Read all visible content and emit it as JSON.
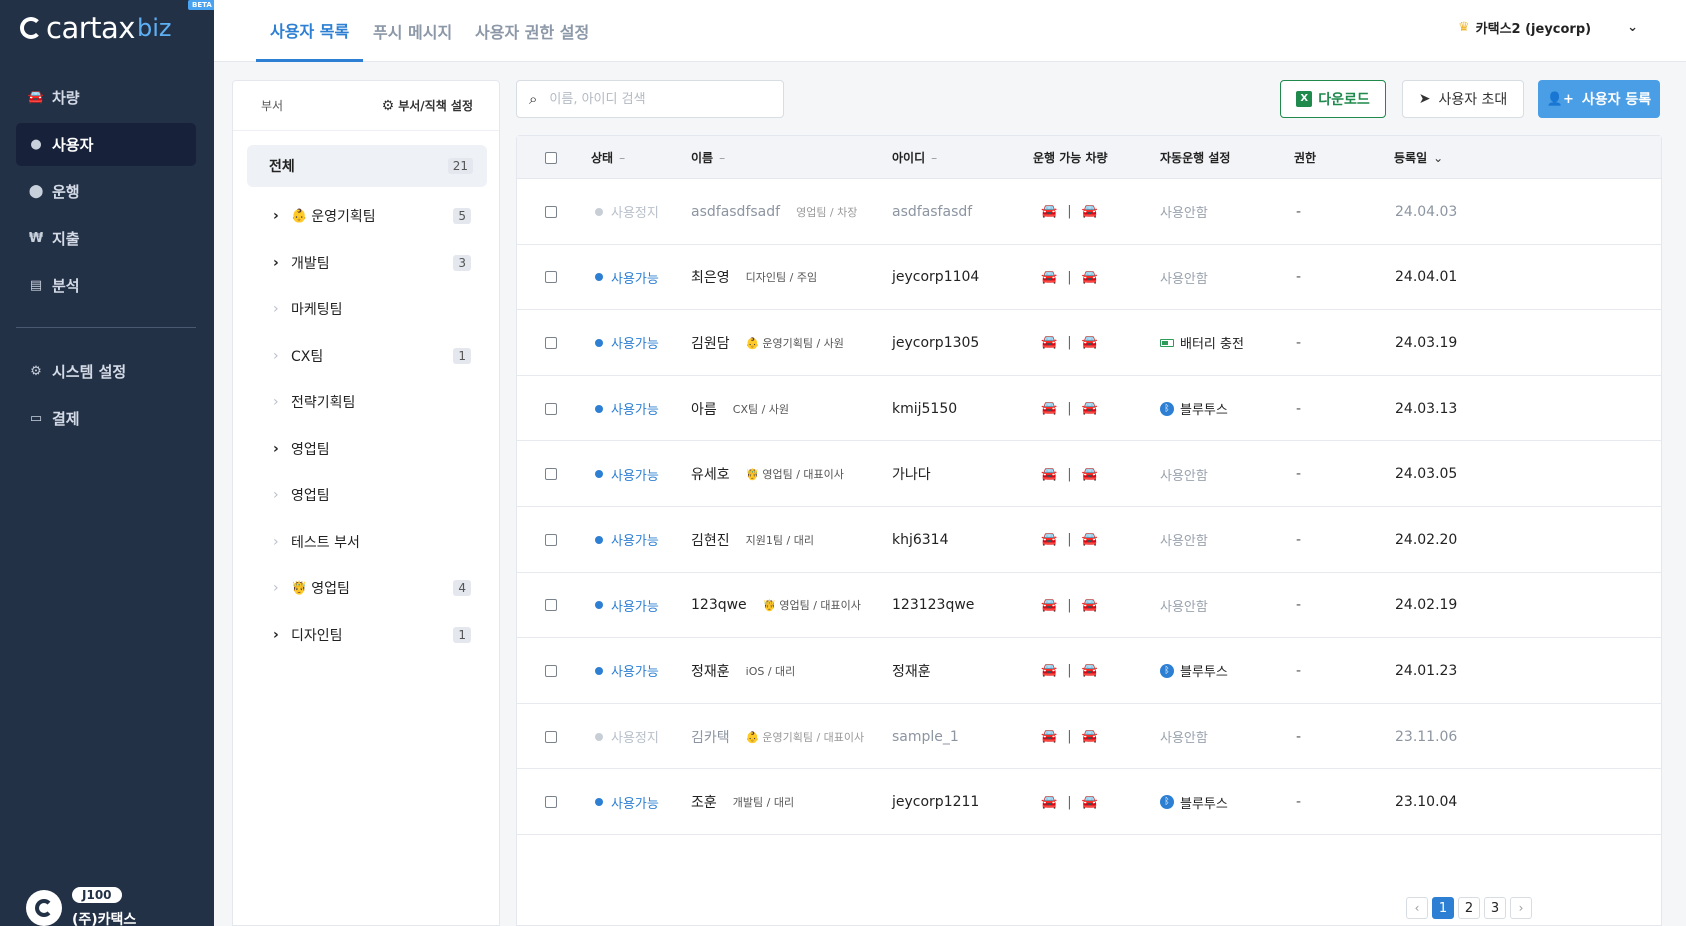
{
  "app": {
    "logo_text": "cartax",
    "logo_suffix": "biz",
    "beta_label": "BETA"
  },
  "sidebar": {
    "items": [
      {
        "label": "차량",
        "icon": "car-icon"
      },
      {
        "label": "사용자",
        "icon": "user-icon",
        "active": true
      },
      {
        "label": "운행",
        "icon": "location-pin-icon"
      },
      {
        "label": "지출",
        "icon": "won-icon"
      },
      {
        "label": "분석",
        "icon": "chart-icon"
      }
    ],
    "items2": [
      {
        "label": "시스템 설정",
        "icon": "gear-icon"
      },
      {
        "label": "결제",
        "icon": "card-icon"
      }
    ],
    "company": {
      "plan": "J100",
      "name": "(주)카택스"
    }
  },
  "tabs": [
    {
      "label": "사용자 목록",
      "active": true
    },
    {
      "label": "푸시 메시지"
    },
    {
      "label": "사용자 권한 설정"
    }
  ],
  "account": {
    "label": "카택스2 (jeycorp)"
  },
  "dept": {
    "title": "부서",
    "settings_label": "부서/직책 설정",
    "all_label": "전체",
    "all_count": "21",
    "items": [
      {
        "label": "운영기획팀",
        "emoji": "👶",
        "expandable": true,
        "count": "5"
      },
      {
        "label": "개발팀",
        "emoji": "",
        "expandable": true,
        "count": "3"
      },
      {
        "label": "마케팅팀",
        "emoji": "",
        "expandable": false,
        "count": ""
      },
      {
        "label": "CX팀",
        "emoji": "",
        "expandable": false,
        "count": "1"
      },
      {
        "label": "전략기획팀",
        "emoji": "",
        "expandable": false,
        "count": ""
      },
      {
        "label": "영업팀",
        "emoji": "",
        "expandable": true,
        "count": ""
      },
      {
        "label": "영업팀",
        "emoji": "",
        "expandable": false,
        "count": ""
      },
      {
        "label": "테스트 부서",
        "emoji": "",
        "expandable": false,
        "count": ""
      },
      {
        "label": "영업팀",
        "emoji": "🤴",
        "expandable": false,
        "count": "4"
      },
      {
        "label": "디자인팀",
        "emoji": "",
        "expandable": true,
        "count": "1"
      }
    ]
  },
  "search": {
    "placeholder": "이름, 아이디 검색"
  },
  "buttons": {
    "download": "다운로드",
    "invite": "사용자 초대",
    "register": "사용자 등록"
  },
  "table": {
    "headers": {
      "status": "상태",
      "name": "이름",
      "id": "아이디",
      "vehicles": "운행 가능 차량",
      "auto": "자동운행 설정",
      "perm": "권한",
      "date": "등록일"
    },
    "rows": [
      {
        "status": "사용정지",
        "active": false,
        "name": "asdfasdfsadf",
        "emoji": "",
        "dept": "영업팀 / 차장",
        "id": "asdfasfasdf",
        "car1": "blue",
        "car2": "faded",
        "auto": "사용안함",
        "auto_type": "none",
        "perm": "-",
        "date": "24.04.03"
      },
      {
        "status": "사용가능",
        "active": true,
        "name": "최은영",
        "emoji": "",
        "dept": "디자인팀 / 주임",
        "id": "jeycorp1104",
        "car1": "blue",
        "car2": "faded",
        "auto": "사용안함",
        "auto_type": "none",
        "perm": "-",
        "date": "24.04.01"
      },
      {
        "status": "사용가능",
        "active": true,
        "name": "김원담",
        "emoji": "👶",
        "dept": "운영기획팀 / 사원",
        "id": "jeycorp1305",
        "car1": "blue",
        "car2": "orange",
        "auto": "배터리 충전",
        "auto_type": "battery",
        "perm": "-",
        "date": "24.03.19"
      },
      {
        "status": "사용가능",
        "active": true,
        "name": "아름",
        "emoji": "",
        "dept": "CX팀 / 사원",
        "id": "kmij5150",
        "car1": "blue",
        "car2": "orange",
        "auto": "블루투스",
        "auto_type": "bluetooth",
        "perm": "-",
        "date": "24.03.13"
      },
      {
        "status": "사용가능",
        "active": true,
        "name": "유세호",
        "emoji": "🤴",
        "dept": "영업팀 / 대표이사",
        "id": "가나다",
        "car1": "blue",
        "car2": "faded",
        "auto": "사용안함",
        "auto_type": "none",
        "perm": "-",
        "date": "24.03.05"
      },
      {
        "status": "사용가능",
        "active": true,
        "name": "김현진",
        "emoji": "",
        "dept": "지원1팀 / 대리",
        "id": "khj6314",
        "car1": "blue",
        "car2": "orange",
        "auto": "사용안함",
        "auto_type": "none",
        "perm": "-",
        "date": "24.02.20"
      },
      {
        "status": "사용가능",
        "active": true,
        "name": "123qwe",
        "emoji": "🤴",
        "dept": "영업팀 / 대표이사",
        "id": "123123qwe",
        "car1": "blue",
        "car2": "orange",
        "auto": "사용안함",
        "auto_type": "none",
        "perm": "-",
        "date": "24.02.19"
      },
      {
        "status": "사용가능",
        "active": true,
        "name": "정재훈",
        "emoji": "",
        "dept": "iOS / 대리",
        "id": "정재훈",
        "car1": "blue",
        "car2": "orange",
        "auto": "블루투스",
        "auto_type": "bluetooth",
        "perm": "-",
        "date": "24.01.23"
      },
      {
        "status": "사용정지",
        "active": false,
        "name": "김카택",
        "emoji": "👶",
        "dept": "운영기획팀 / 대표이사",
        "id": "sample_1",
        "car1": "faded",
        "car2": "faded-o",
        "auto": "사용안함",
        "auto_type": "none",
        "perm": "-",
        "date": "23.11.06"
      },
      {
        "status": "사용가능",
        "active": true,
        "name": "조훈",
        "emoji": "",
        "dept": "개발팀 / 대리",
        "id": "jeycorp1211",
        "car1": "faded",
        "car2": "orange",
        "auto": "블루투스",
        "auto_type": "bluetooth",
        "perm": "-",
        "date": "23.10.04"
      }
    ]
  },
  "pagination": {
    "pages": [
      "1",
      "2",
      "3"
    ],
    "current": "1",
    "prev": "‹",
    "next": "›"
  }
}
